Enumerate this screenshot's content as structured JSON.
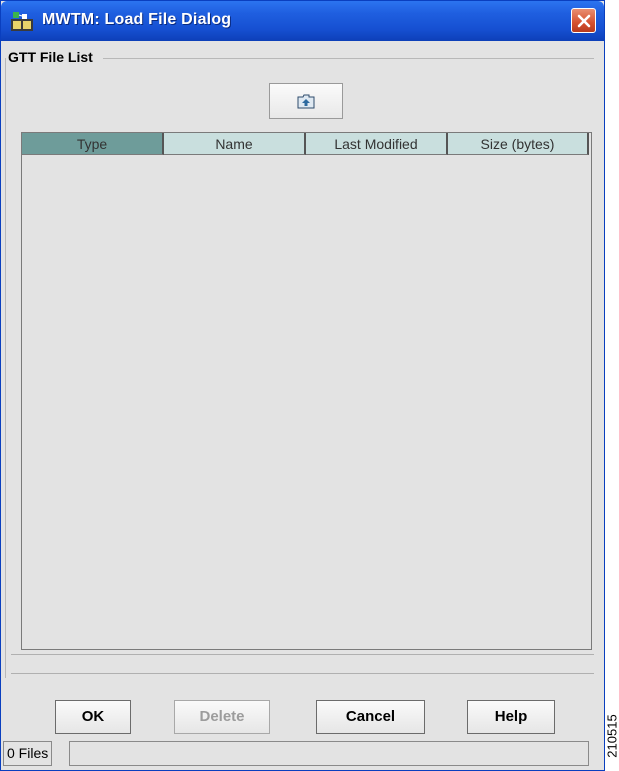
{
  "window": {
    "title": "MWTM: Load File Dialog",
    "app_icon": "mwtm-app-icon",
    "close_icon": "close-x-icon",
    "titlebar_color": "#1f5fe0",
    "close_color": "#d5512f"
  },
  "file_list": {
    "group_title": "GTT File List",
    "up_folder_icon": "up-one-level-folder-icon",
    "columns": [
      "Type",
      "Name",
      "Last Modified",
      "Size (bytes)"
    ],
    "sorted_column": "Type",
    "header_color": "#c9dfde",
    "sorted_header_color": "#6e9c9a",
    "rows": []
  },
  "buttons": {
    "ok": "OK",
    "delete": "Delete",
    "cancel": "Cancel",
    "help": "Help",
    "delete_enabled": false
  },
  "status": {
    "file_count": "0 Files",
    "status_message": ""
  },
  "figure_code": "210515"
}
